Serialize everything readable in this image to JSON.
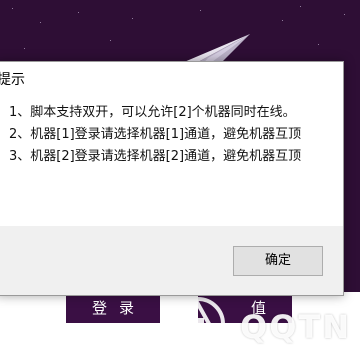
{
  "background": {
    "login_button_label": "登录",
    "recharge_button_label": "值",
    "watermark_text": "QQTN"
  },
  "dialog": {
    "title": "提示",
    "lines": [
      "1、脚本支持双开，可以允许[2]个机器同时在线。",
      "2、机器[1]登录请选择机器[1]通道，避免机器互顶",
      "3、机器[2]登录请选择机器[2]通道，避免机器互顶"
    ],
    "ok_button_label": "确定"
  },
  "colors": {
    "background": "#2e0e35",
    "button_bg": "#3a0f44",
    "dialog_bg": "#ffffff",
    "dialog_footer": "#f0f0f0"
  }
}
